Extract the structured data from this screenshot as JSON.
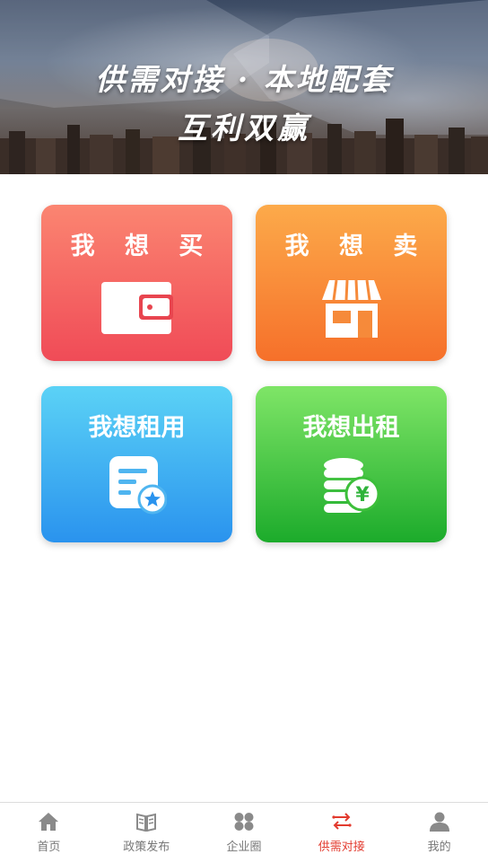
{
  "banner": {
    "line1": "供需对接 · 本地配套",
    "line2": "互利双赢"
  },
  "cards": [
    {
      "label": "我 想 买",
      "icon": "wallet-icon"
    },
    {
      "label": "我 想 卖",
      "icon": "storefront-icon"
    },
    {
      "label": "我想租用",
      "icon": "document-star-icon"
    },
    {
      "label": "我想出租",
      "icon": "coins-yen-icon"
    }
  ],
  "tabbar": {
    "items": [
      {
        "label": "首页",
        "icon": "home-icon",
        "active": false
      },
      {
        "label": "政策发布",
        "icon": "book-icon",
        "active": false
      },
      {
        "label": "企业圈",
        "icon": "four-dots-icon",
        "active": false
      },
      {
        "label": "供需对接",
        "icon": "exchange-arrows-icon",
        "active": true
      },
      {
        "label": "我的",
        "icon": "user-icon",
        "active": false
      }
    ],
    "active_color": "#e23a2e",
    "inactive_color": "#777777"
  }
}
